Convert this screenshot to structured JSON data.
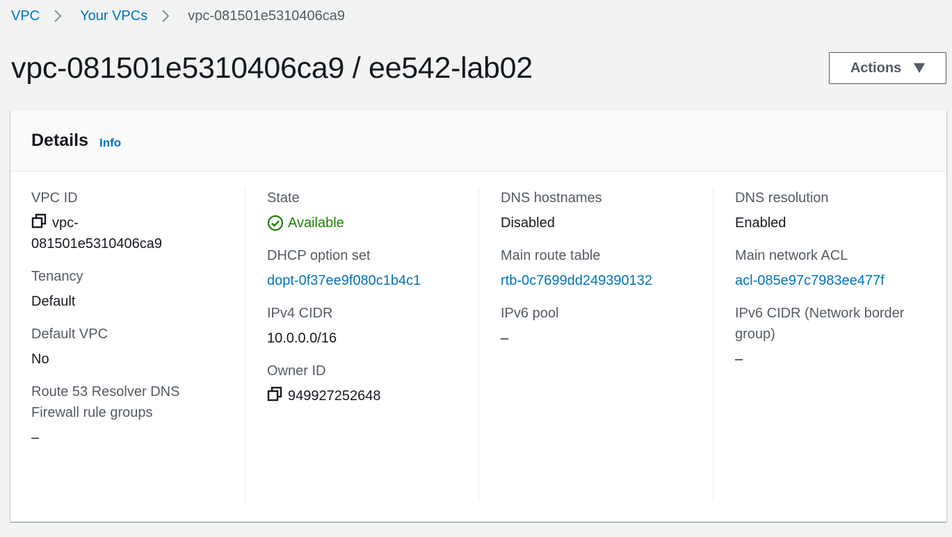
{
  "breadcrumb": {
    "items": [
      "VPC",
      "Your VPCs"
    ],
    "current": "vpc-081501e5310406ca9"
  },
  "header": {
    "title": "vpc-081501e5310406ca9 / ee542-lab02",
    "actions_label": "Actions"
  },
  "details": {
    "title": "Details",
    "info_label": "Info",
    "vpc_id": {
      "label": "VPC ID",
      "value_line1": "vpc-",
      "value_line2": "081501e5310406ca9"
    },
    "tenancy": {
      "label": "Tenancy",
      "value": "Default"
    },
    "default_vpc": {
      "label": "Default VPC",
      "value": "No"
    },
    "route53": {
      "label": "Route 53 Resolver DNS Firewall rule groups",
      "value": "–"
    },
    "state": {
      "label": "State",
      "value": "Available",
      "color": "#1d8102"
    },
    "dhcp": {
      "label": "DHCP option set",
      "value": "dopt-0f37ee9f080c1b4c1"
    },
    "ipv4_cidr": {
      "label": "IPv4 CIDR",
      "value": "10.0.0.0/16"
    },
    "owner_id": {
      "label": "Owner ID",
      "value": "949927252648"
    },
    "dns_hostnames": {
      "label": "DNS hostnames",
      "value": "Disabled"
    },
    "main_route_table": {
      "label": "Main route table",
      "value": "rtb-0c7699dd249390132"
    },
    "ipv6_pool": {
      "label": "IPv6 pool",
      "value": "–"
    },
    "dns_resolution": {
      "label": "DNS resolution",
      "value": "Enabled"
    },
    "main_network_acl": {
      "label": "Main network ACL",
      "value": "acl-085e97c7983ee477f"
    },
    "ipv6_cidr": {
      "label": "IPv6 CIDR (Network border group)",
      "value": "–"
    }
  },
  "colors": {
    "link": "#0073bb",
    "text": "#16191f",
    "label": "#545b64",
    "success": "#1d8102"
  }
}
